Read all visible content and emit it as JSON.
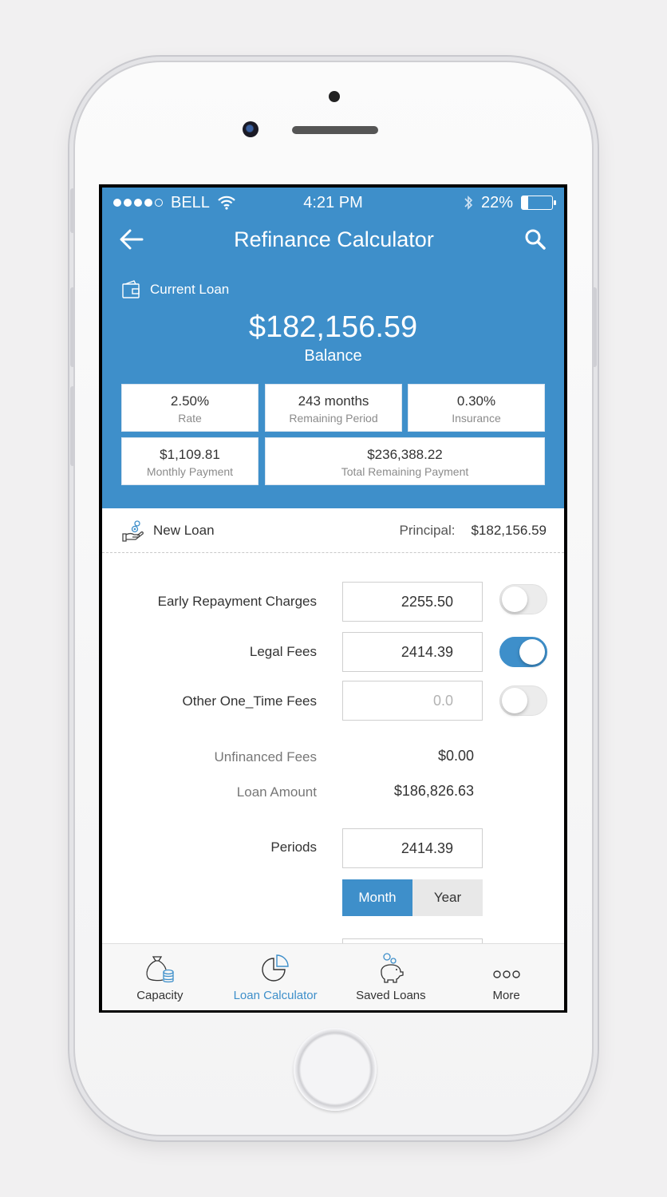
{
  "status_bar": {
    "carrier": "BELL",
    "time": "4:21 PM",
    "battery_percent": "22%",
    "battery_level": 0.22,
    "signal_icon": "signal-dots-icon",
    "wifi_icon": "wifi-icon",
    "bluetooth_icon": "bluetooth-icon"
  },
  "nav": {
    "title": "Refinance Calculator",
    "back_icon": "back-arrow-icon",
    "search_icon": "search-icon"
  },
  "current_loan": {
    "label": "Current Loan",
    "icon": "wallet-icon",
    "balance": "$182,156.59",
    "balance_label": "Balance",
    "stats": [
      {
        "value": "2.50%",
        "label": "Rate"
      },
      {
        "value": "243 months",
        "label": "Remaining Period"
      },
      {
        "value": "0.30%",
        "label": "Insurance"
      },
      {
        "value": "$1,109.81",
        "label": "Monthly Payment"
      },
      {
        "value": "$236,388.22",
        "label": "Total Remaining Payment"
      }
    ]
  },
  "new_loan": {
    "label": "New Loan",
    "icon": "hand-coins-icon",
    "principal_label": "Principal:",
    "principal_value": "$182,156.59"
  },
  "form": {
    "early_repayment": {
      "label": "Early Repayment Charges",
      "value": "2255.50",
      "toggle_on": false
    },
    "legal_fees": {
      "label": "Legal Fees",
      "value": "2414.39",
      "toggle_on": true
    },
    "other_fees": {
      "label": "Other One_Time Fees",
      "placeholder": "0.0",
      "toggle_on": false
    },
    "unfinanced_fees": {
      "label": "Unfinanced Fees",
      "value": "$0.00"
    },
    "loan_amount": {
      "label": "Loan Amount",
      "value": "$186,826.63"
    },
    "periods": {
      "label": "Periods",
      "value": "2414.39"
    },
    "period_unit": {
      "options": [
        "Month",
        "Year"
      ],
      "selected": "Month"
    }
  },
  "tabs": [
    {
      "label": "Capacity",
      "icon": "money-bag-icon",
      "active": false
    },
    {
      "label": "Loan Calculator",
      "icon": "pie-chart-icon",
      "active": true
    },
    {
      "label": "Saved Loans",
      "icon": "piggy-bank-icon",
      "active": false
    },
    {
      "label": "More",
      "icon": "more-dots-icon",
      "active": false
    }
  ],
  "colors": {
    "accent": "#3e8fca",
    "background": "#f1f0f1"
  }
}
